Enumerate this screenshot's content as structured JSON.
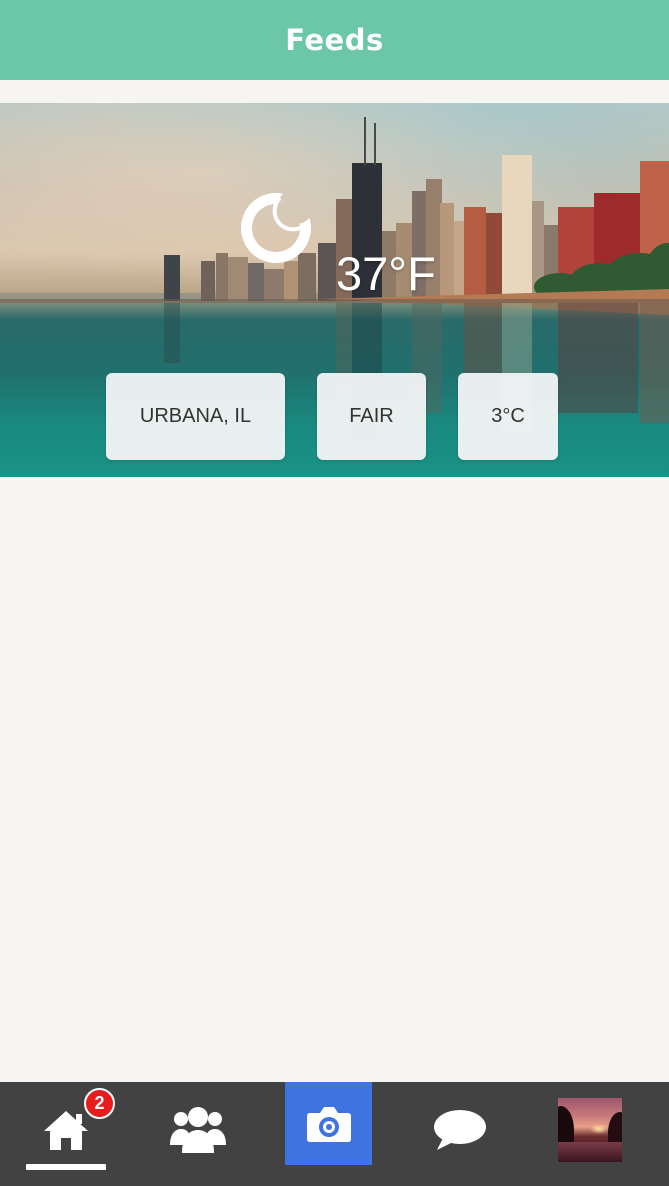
{
  "header": {
    "title": "Feeds",
    "color": "#6bc7a8"
  },
  "weather": {
    "icon": "moon-icon",
    "temperature_f": "37°F",
    "location": "URBANA, IL",
    "condition": "FAIR",
    "temperature_c": "3°C"
  },
  "tabbar": {
    "items": [
      {
        "name": "home",
        "icon": "home-icon",
        "badge": "2",
        "selected": true
      },
      {
        "name": "friends",
        "icon": "users-icon"
      },
      {
        "name": "camera",
        "icon": "camera-icon",
        "accent": "#3f73e0"
      },
      {
        "name": "messages",
        "icon": "speech-bubble-icon"
      },
      {
        "name": "profile",
        "icon": "profile-thumbnail"
      }
    ]
  }
}
